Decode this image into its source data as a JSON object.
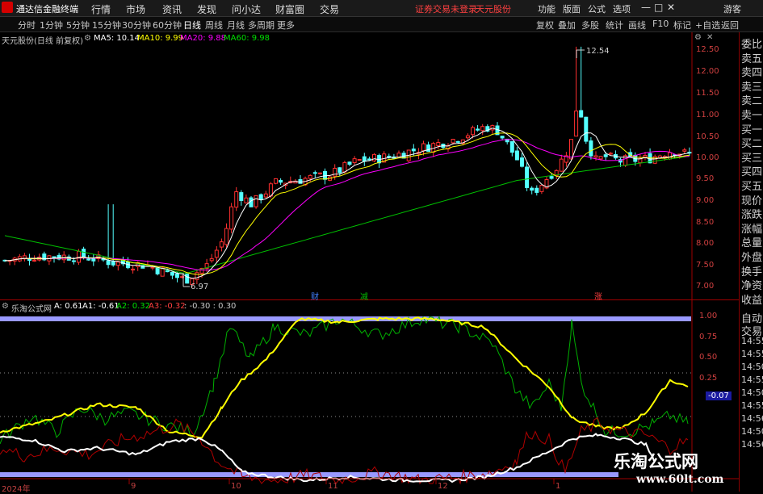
{
  "menubar": {
    "app_title": "通达信金融终端",
    "items": [
      "行情",
      "市场",
      "资讯",
      "发现",
      "问小达",
      "财富圈",
      "交易"
    ],
    "warning": "证券交易未登录",
    "stock_name": "天元股份",
    "right_items": [
      "功能",
      "版面",
      "公式",
      "选项"
    ],
    "user": "游客",
    "window_controls": [
      "—",
      "□",
      "✕"
    ]
  },
  "toolbar": {
    "periods": [
      "分时",
      "1分钟",
      "5分钟",
      "15分钟",
      "30分钟",
      "60分钟",
      "日线",
      "周线",
      "月线",
      "多周期",
      "更多"
    ],
    "active_period": "日线",
    "right_items": [
      "复权",
      "叠加",
      "多股",
      "统计",
      "画线",
      "F10",
      "标记",
      "+自选",
      "返回"
    ]
  },
  "chart_info": {
    "title": "天元股份(日线 前复权)",
    "ma5": "MA5: 10.14",
    "ma10": "MA10: 9.99",
    "ma20": "MA20: 9.88",
    "ma60": "MA60: 9.98"
  },
  "indicator_info": {
    "name": "乐淘公式网",
    "a": "A: 0.61",
    "a1": "A1: -0.61",
    "a2": "A2: 0.32",
    "a3": "A3: -0.32",
    "rest": ": -0.30 : 0.30"
  },
  "annotations": {
    "high": "12.54",
    "low": "6.97",
    "marker1": "财",
    "marker2": "减",
    "marker3": "涨"
  },
  "right_panel": {
    "labels": [
      "委比",
      "卖五",
      "卖四",
      "卖三",
      "卖二",
      "卖一",
      "买一",
      "买二",
      "买三",
      "买四",
      "买五",
      "现价",
      "涨跌",
      "涨幅",
      "总量",
      "外盘",
      "换手",
      "净资",
      "收益"
    ],
    "indicator_labels": [
      "自动",
      "交易",
      "14:55",
      "14:55",
      "14:50",
      "14:55",
      "14:50",
      "14:55",
      "14:56",
      "14:50",
      "14:56"
    ],
    "indicator_value": "-0.07"
  },
  "price_axis": [
    "12.50",
    "12.00",
    "11.50",
    "11.00",
    "10.50",
    "10.00",
    "9.50",
    "9.00",
    "8.50",
    "8.00",
    "7.50",
    "7.00"
  ],
  "ind_axis": [
    "1.00",
    "0.75",
    "0.50",
    "0.25"
  ],
  "x_axis": [
    "2024年",
    "9",
    "10",
    "11",
    "12",
    "1"
  ],
  "watermark": {
    "line1": "乐淘公式网",
    "line2": "www.60lt.com"
  },
  "colors": {
    "up": "#ff3030",
    "down": "#54ffff",
    "ma5": "#ffffff",
    "ma10": "#ffff00",
    "ma20": "#ff00ff",
    "ma60": "#00c000",
    "band": "#9999ff"
  }
}
